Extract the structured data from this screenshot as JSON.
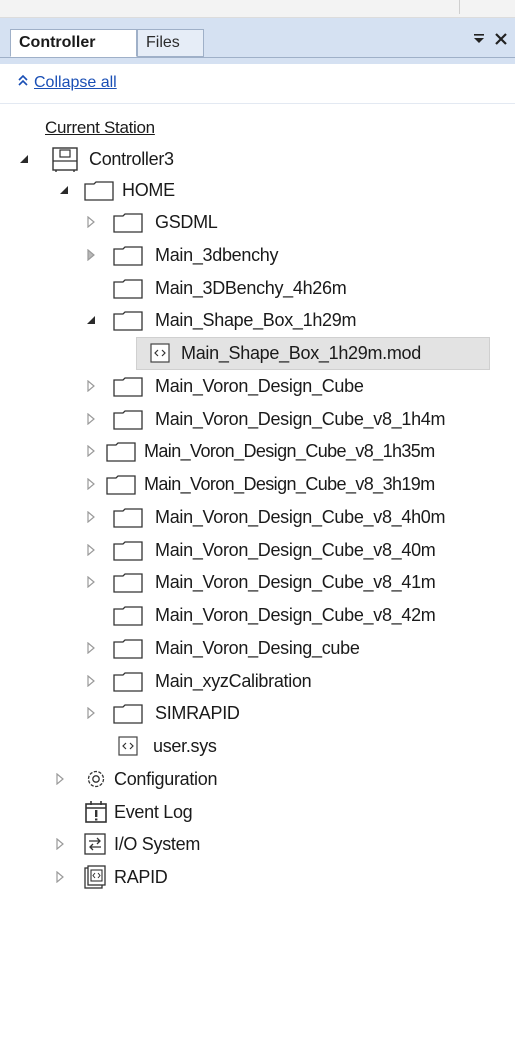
{
  "tabs": {
    "controller": "Controller",
    "files": "Files"
  },
  "panel_controls": {
    "pin": "⩿",
    "close": "✕"
  },
  "toolbar": {
    "collapse_all": "Collapse all"
  },
  "tree": {
    "current_station": "Current Station",
    "controller": "Controller3",
    "home": "HOME",
    "home_items": [
      "GSDML",
      "Main_3dbenchy",
      "Main_3DBenchy_4h26m",
      "Main_Shape_Box_1h29m",
      "Main_Shape_Box_1h29m.mod",
      "Main_Voron_Design_Cube",
      "Main_Voron_Design_Cube_v8_1h4m",
      "Main_Voron_Design_Cube_v8_1h35m",
      "Main_Voron_Design_Cube_v8_3h19m",
      "Main_Voron_Design_Cube_v8_4h0m",
      "Main_Voron_Design_Cube_v8_40m",
      "Main_Voron_Design_Cube_v8_41m",
      "Main_Voron_Design_Cube_v8_42m",
      "Main_Voron_Desing_cube",
      "Main_xyzCalibration",
      "SIMRAPID",
      "user.sys"
    ],
    "configuration": "Configuration",
    "event_log": "Event Log",
    "io_system": "I/O System",
    "rapid": "RAPID"
  },
  "colors": {
    "tab_bar": "#d5e1f2",
    "link": "#1a4fb5",
    "selection": "#e3e3e3"
  }
}
